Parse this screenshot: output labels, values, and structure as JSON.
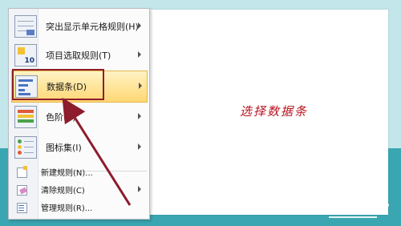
{
  "menu": {
    "items_big": [
      {
        "label": "突出显示单元格规则(H)",
        "icon": "highlight-cells-rules-icon",
        "submenu": true
      },
      {
        "label": "项目选取规则(T)",
        "icon": "top-bottom-rules-icon",
        "submenu": true
      },
      {
        "label": "数据条(D)",
        "icon": "data-bars-icon",
        "submenu": true,
        "selected": true
      },
      {
        "label": "色阶(S)",
        "icon": "color-scales-icon",
        "submenu": true
      },
      {
        "label": "图标集(I)",
        "icon": "icon-sets-icon",
        "submenu": true
      }
    ],
    "items_small": [
      {
        "label": "新建规则(N)...",
        "icon": "new-rule-icon",
        "submenu": false
      },
      {
        "label": "清除规则(C)",
        "icon": "clear-rules-icon",
        "submenu": true
      },
      {
        "label": "管理规则(R)...",
        "icon": "manage-rules-icon",
        "submenu": false
      }
    ]
  },
  "annotation": {
    "text": "选择数据条",
    "color": "#b8141f"
  },
  "colors": {
    "highlight_border": "#8d1c2d",
    "selected_fill": "#ffd774",
    "arrow": "#8d1c2d"
  }
}
